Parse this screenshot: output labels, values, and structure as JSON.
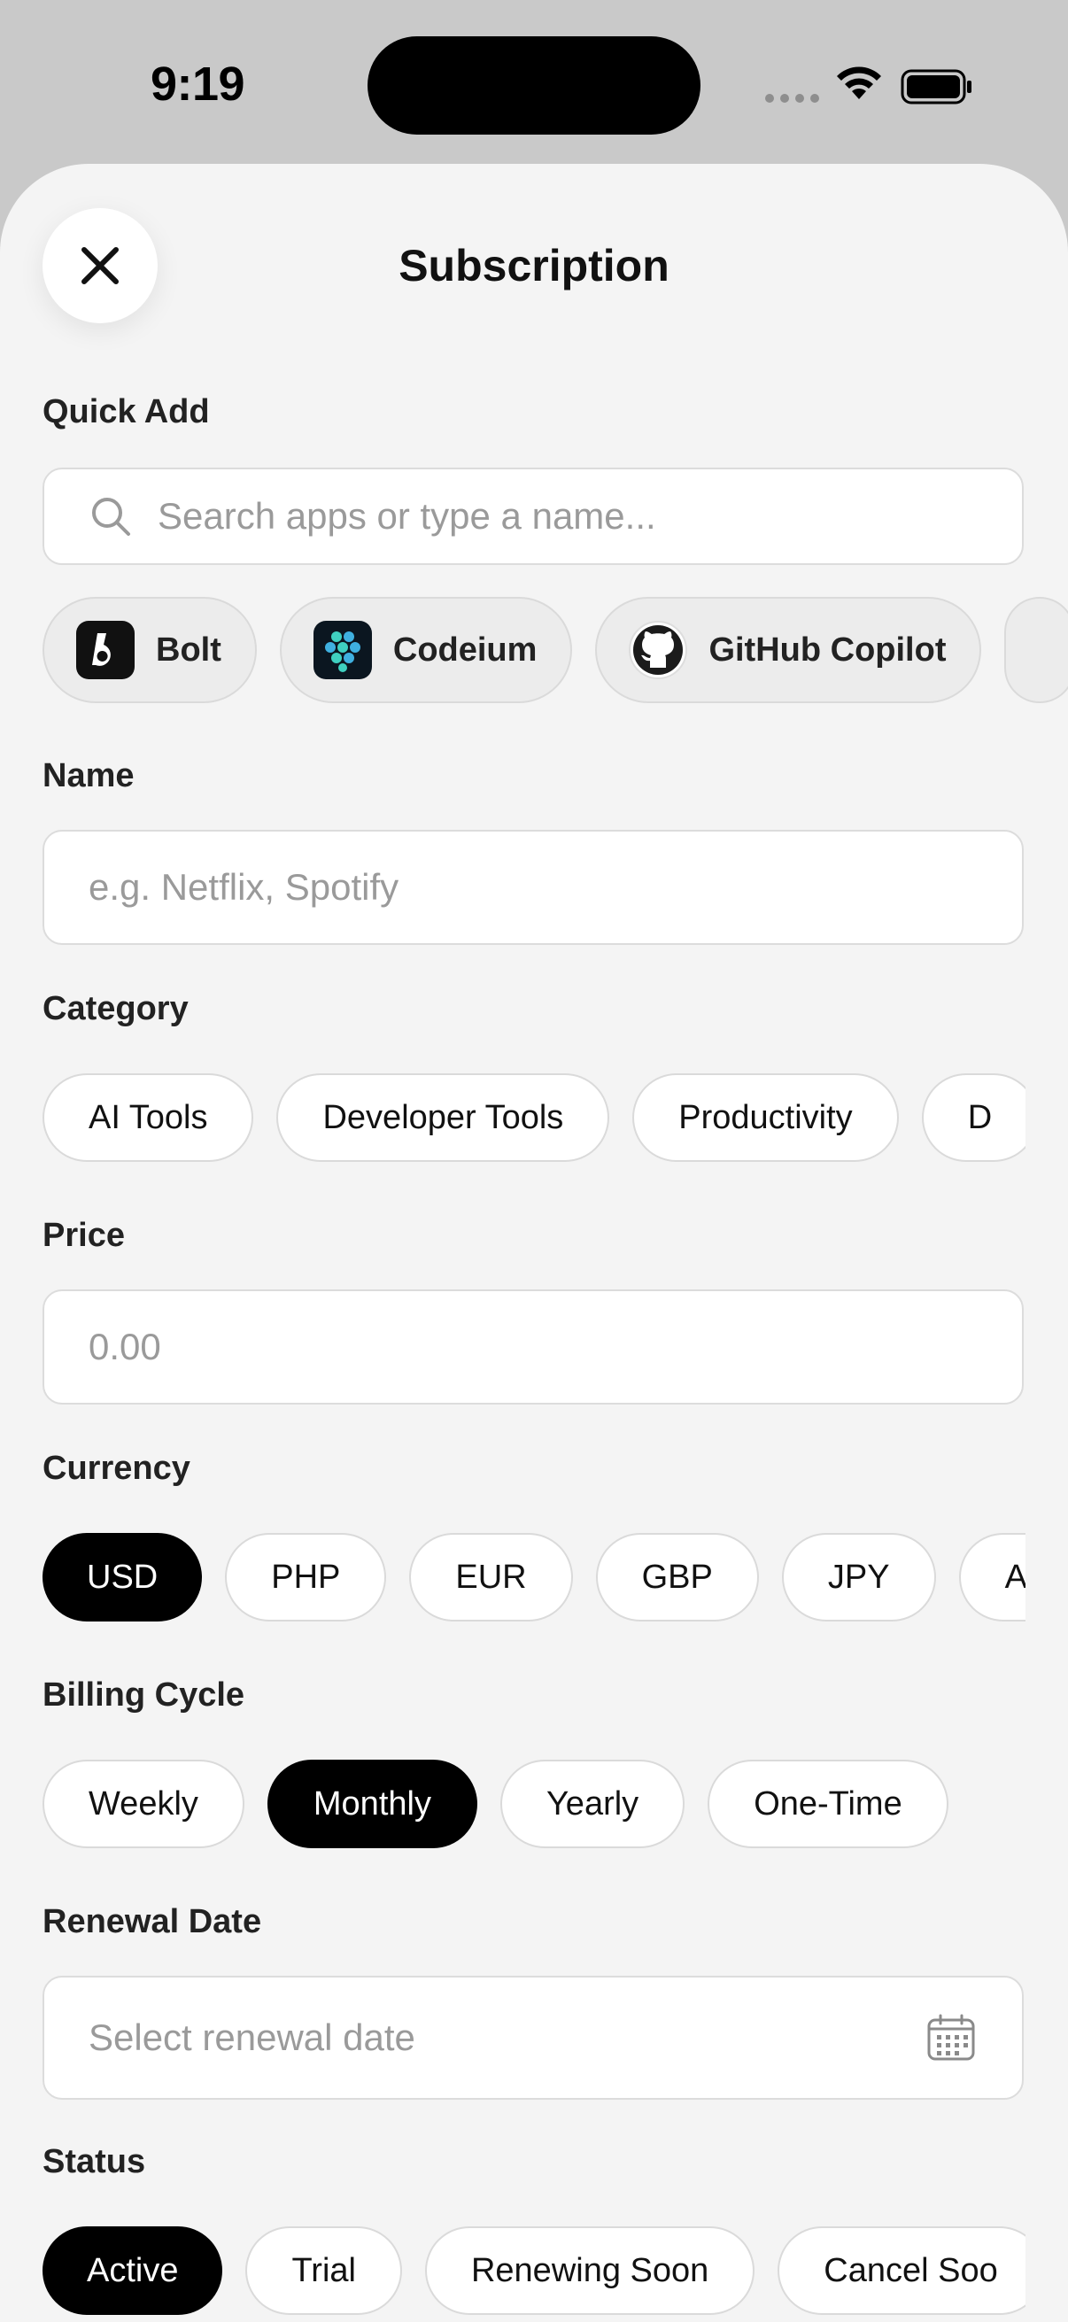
{
  "status_bar": {
    "time": "9:19"
  },
  "header": {
    "title": "Subscription",
    "close_icon": "close-icon"
  },
  "quick_add": {
    "label": "Quick Add",
    "search_placeholder": "Search apps or type a name...",
    "apps": [
      {
        "name": "Bolt",
        "icon": "bolt-logo-icon"
      },
      {
        "name": "Codeium",
        "icon": "codeium-logo-icon"
      },
      {
        "name": "GitHub Copilot",
        "icon": "github-logo-icon"
      }
    ]
  },
  "name": {
    "label": "Name",
    "placeholder": "e.g. Netflix, Spotify"
  },
  "category": {
    "label": "Category",
    "options": [
      "AI Tools",
      "Developer Tools",
      "Productivity",
      "D"
    ]
  },
  "price": {
    "label": "Price",
    "placeholder": "0.00"
  },
  "currency": {
    "label": "Currency",
    "selected": "USD",
    "options": [
      "USD",
      "PHP",
      "EUR",
      "GBP",
      "JPY",
      "AU"
    ]
  },
  "billing_cycle": {
    "label": "Billing Cycle",
    "selected": "Monthly",
    "options": [
      "Weekly",
      "Monthly",
      "Yearly",
      "One-Time"
    ]
  },
  "renewal_date": {
    "label": "Renewal Date",
    "placeholder": "Select renewal date",
    "icon": "calendar-icon"
  },
  "status": {
    "label": "Status",
    "selected": "Active",
    "options": [
      "Active",
      "Trial",
      "Renewing Soon",
      "Cancel Soo"
    ]
  },
  "colors": {
    "sheet_background": "#f4f4f4",
    "selected_chip": "#000000",
    "chip_border": "#dadada",
    "placeholder_text": "#9a9a9a"
  }
}
